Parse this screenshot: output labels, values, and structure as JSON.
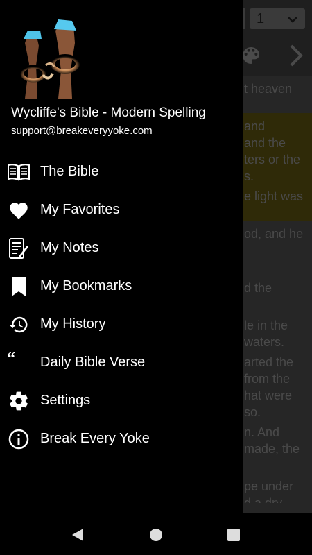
{
  "background": {
    "chapter_value": "1",
    "text_lines": [
      "t heaven",
      "and",
      "and the",
      "ters or the",
      "s.",
      "e light was",
      "od, and he",
      "d the",
      "le in the",
      "waters.",
      "arted the",
      "from the",
      "hat were",
      "so.",
      "n. And",
      "made, the",
      "pe under",
      "d a dry"
    ]
  },
  "drawer": {
    "title": "Wycliffe's Bible - Modern Spelling",
    "email": "support@breakeveryyoke.com",
    "items": [
      {
        "label": "The Bible",
        "icon": "book-icon"
      },
      {
        "label": "My Favorites",
        "icon": "heart-icon"
      },
      {
        "label": "My Notes",
        "icon": "notes-icon"
      },
      {
        "label": "My Bookmarks",
        "icon": "bookmark-icon"
      },
      {
        "label": "My History",
        "icon": "history-icon"
      },
      {
        "label": "Daily Bible Verse",
        "icon": "quote-icon"
      },
      {
        "label": "Settings",
        "icon": "gear-icon"
      },
      {
        "label": "Break Every Yoke",
        "icon": "info-icon"
      }
    ]
  },
  "colors": {
    "drawer_bg": "#000000",
    "text": "#ffffff",
    "dimmed_content": "#262626",
    "highlight": "#2f2a08"
  }
}
